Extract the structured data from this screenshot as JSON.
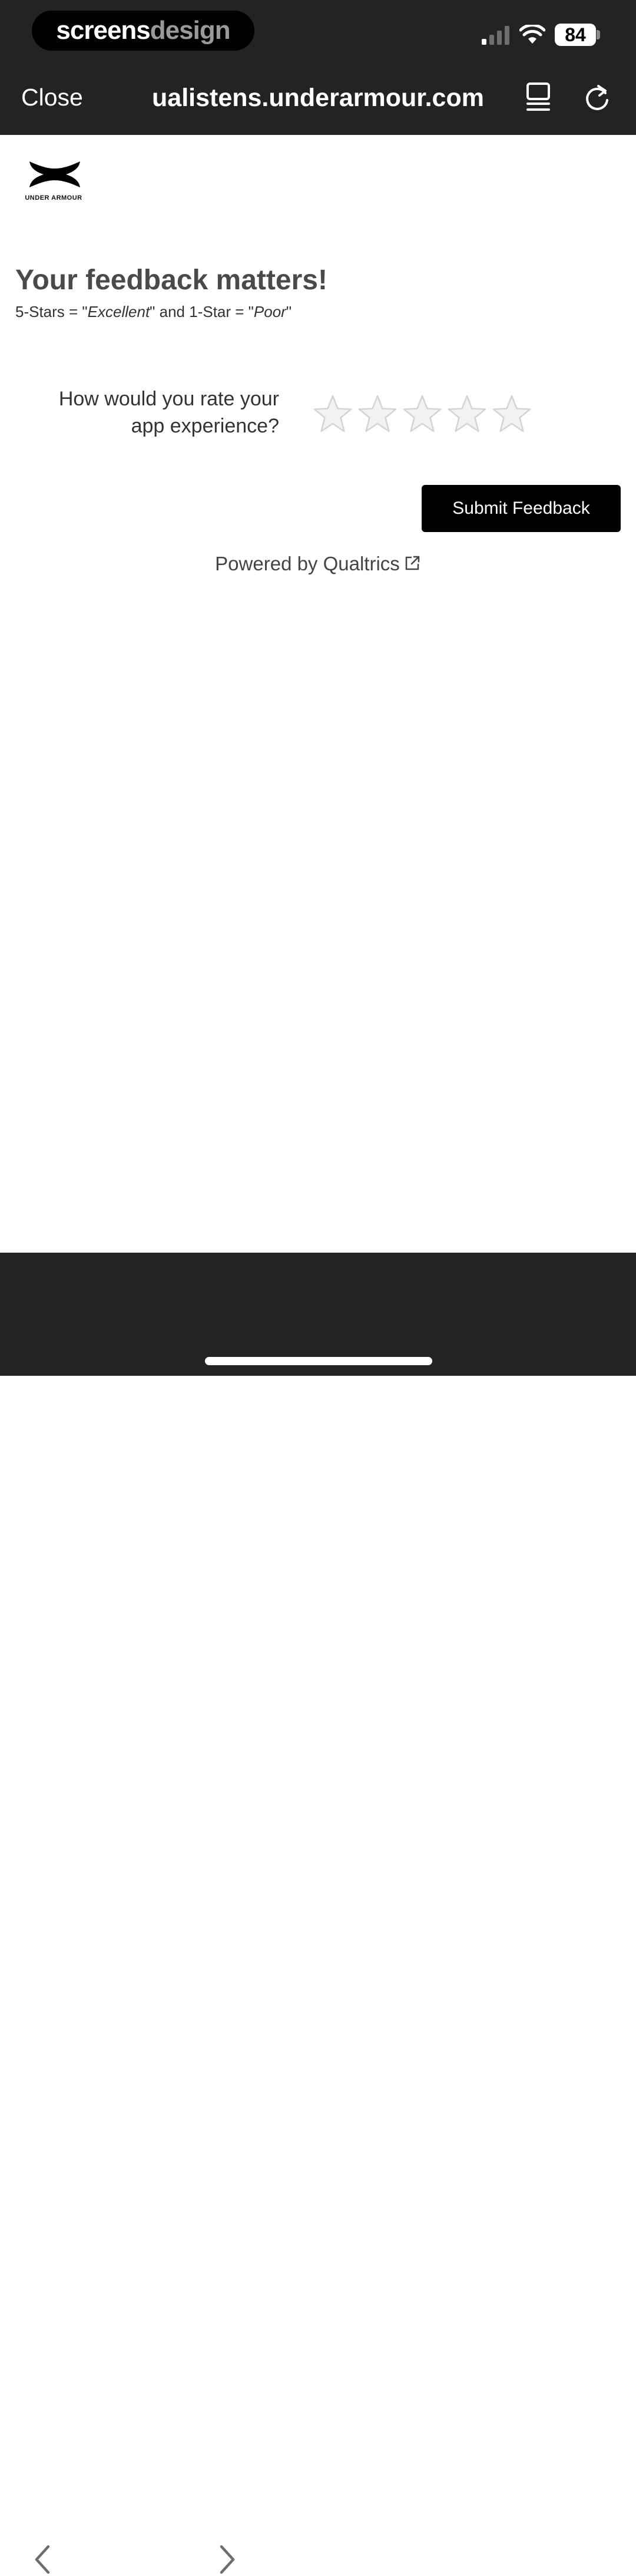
{
  "watermark": {
    "part_a": "screens",
    "part_b": "design"
  },
  "status_bar": {
    "battery": "84",
    "signal_icon": "cellular-signal-icon",
    "wifi_icon": "wifi-icon"
  },
  "browser": {
    "close_label": "Close",
    "url": "ualistens.underarmour.com",
    "reader_icon": "reader-mode-icon",
    "reload_icon": "reload-icon"
  },
  "page": {
    "logo_text": "UNDER ARMOUR",
    "heading": "Your feedback matters!",
    "scale_prefix": "5-Stars = \"",
    "scale_excellent": "Excellent",
    "scale_middle": "\" and 1-Star = \"",
    "scale_poor": "Poor",
    "scale_suffix": "\"",
    "question": "How would you rate your app experience?",
    "rating": {
      "max_stars": 5,
      "selected": 0
    },
    "submit_label": "Submit Feedback",
    "powered_by": "Powered by Qualtrics"
  },
  "toolbar": {
    "back_icon": "chevron-left-icon",
    "forward_icon": "chevron-right-icon",
    "share_icon": "share-icon",
    "safari_icon": "compass-icon"
  },
  "colors": {
    "chrome_bg": "#232326",
    "button_bg": "#000000",
    "star_fill": "#f2f2f2",
    "star_stroke": "#d4d4d4"
  }
}
